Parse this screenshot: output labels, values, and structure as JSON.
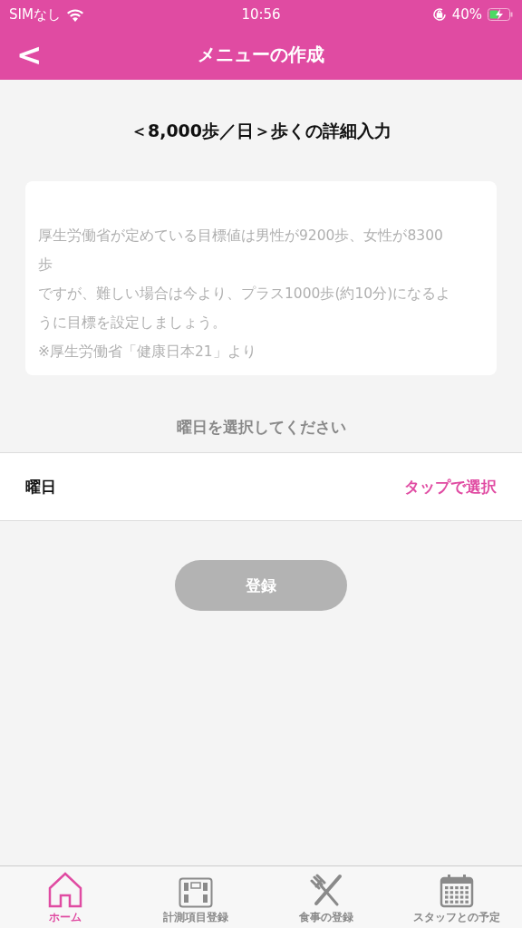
{
  "status_bar": {
    "carrier": "SIMなし",
    "time": "10:56",
    "battery": "40%"
  },
  "header": {
    "back": "<",
    "title": "メニューの作成"
  },
  "heading": "＜8,000歩／日＞歩くの詳細入力",
  "note": {
    "lines": [
      "厚生労働省が定めている目標値は男性が9200歩、女性が8300",
      "歩",
      "ですが、難しい場合は今より、プラス1000歩(約10分)になるよ",
      "うに目標を設定しましょう。",
      "※厚生労働省「健康日本21」より"
    ]
  },
  "prompt": "曜日を選択してください",
  "day_row": {
    "label": "曜日",
    "action": "タップで選択"
  },
  "submit": {
    "label": "登録",
    "disabled": true
  },
  "tabs": [
    {
      "kind": "home",
      "label": "ホーム",
      "selected": true
    },
    {
      "kind": "scale",
      "label": "計測項目登録",
      "selected": false
    },
    {
      "kind": "meal",
      "label": "食事の登録",
      "selected": false
    },
    {
      "kind": "calendar",
      "label": "スタッフとの予定",
      "selected": false
    }
  ]
}
